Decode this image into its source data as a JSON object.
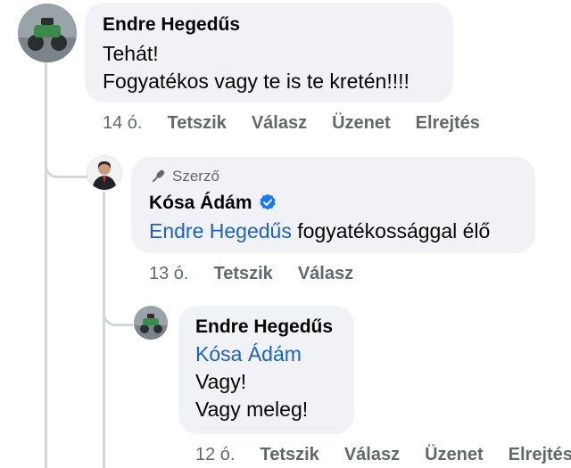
{
  "comments": [
    {
      "author": "Endre Hegedűs",
      "lines": [
        "Tehát!",
        "Fogyatékos vagy te is te kretén!!!!"
      ],
      "time": "14 ó.",
      "actions": [
        "Tetszik",
        "Válasz",
        "Üzenet",
        "Elrejtés"
      ]
    },
    {
      "badge": "Szerző",
      "author": "Kósa Ádám",
      "mention": "Endre Hegedűs",
      "text_after_mention": " fogyatékossággal élő",
      "time": "13 ó.",
      "actions": [
        "Tetszik",
        "Válasz"
      ]
    },
    {
      "author": "Endre Hegedűs",
      "mention": "Kósa Ádám",
      "lines": [
        "Vagy!",
        "Vagy meleg!"
      ],
      "time": "12 ó.",
      "actions": [
        "Tetszik",
        "Válasz",
        "Üzenet",
        "Elrejtés"
      ]
    }
  ],
  "colors": {
    "bubble": "#f0f2f5",
    "mention": "#1a63c4",
    "meta": "#65676b",
    "verified": "#1877f2"
  },
  "icons": [
    "microphone-icon",
    "verified-badge-icon"
  ]
}
